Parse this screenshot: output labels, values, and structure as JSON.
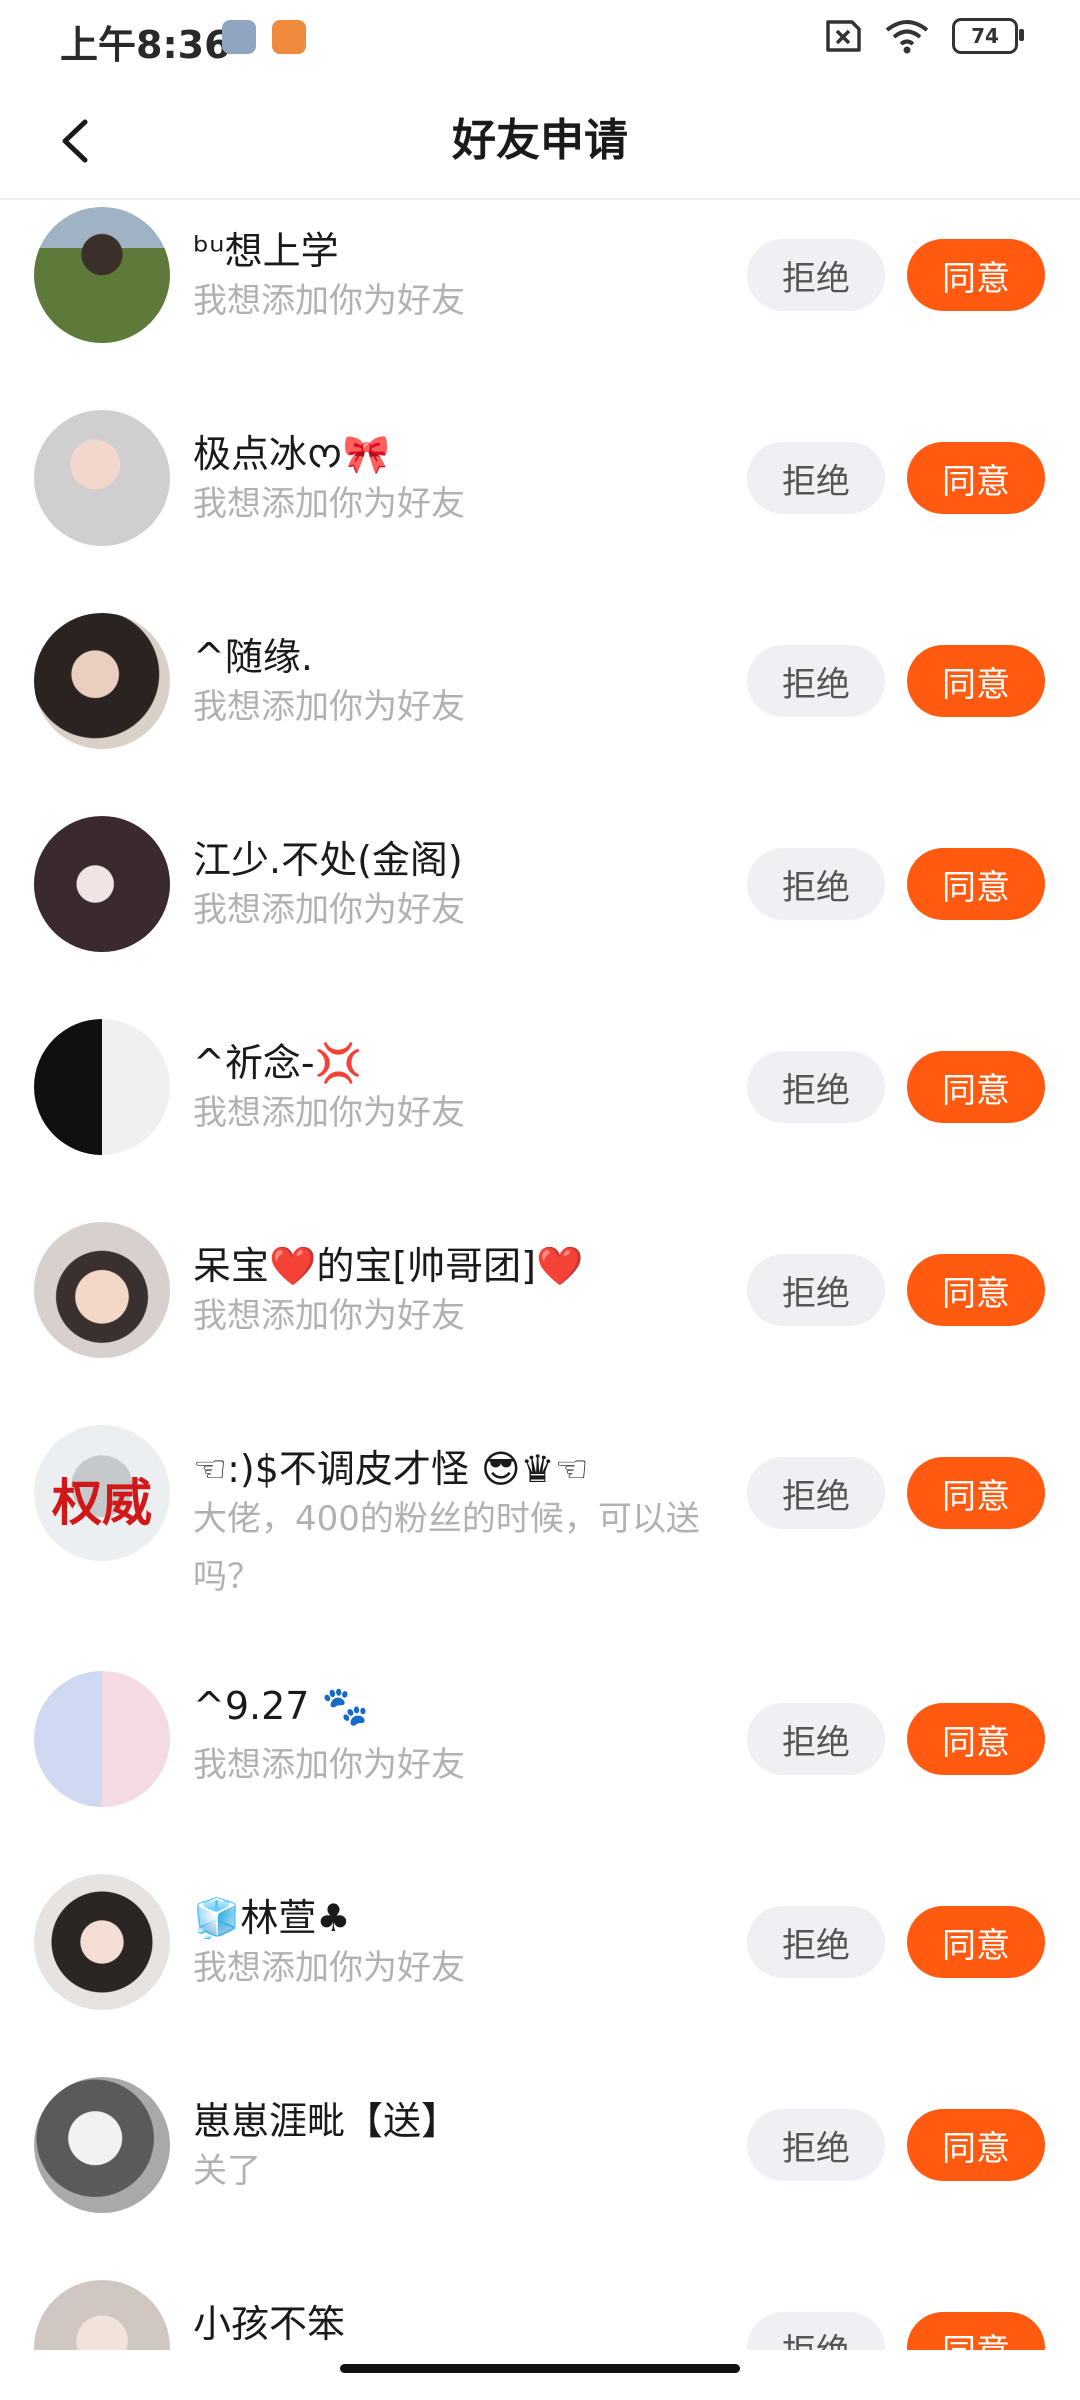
{
  "status_bar": {
    "time": "上午8:36",
    "battery": "74"
  },
  "header": {
    "title": "好友申请"
  },
  "buttons": {
    "reject": "拒绝",
    "accept": "同意"
  },
  "requests": [
    {
      "name": "ᵇᵘ想上学",
      "message": "我想添加你为好友"
    },
    {
      "name": "极点冰ᰔ🎀",
      "message": "我想添加你为好友"
    },
    {
      "name": "^随缘.",
      "message": "我想添加你为好友"
    },
    {
      "name": "江少.不处(金阁)",
      "message": "我想添加你为好友"
    },
    {
      "name": "^祈念-💢",
      "message": "我想添加你为好友"
    },
    {
      "name": "呆宝❤️的宝[帅哥团]❤️",
      "message": "我想添加你为好友"
    },
    {
      "name": "☜:)$不调皮才怪 😎♛☜",
      "message": "大佬，400的粉丝的时候，可以送吗？",
      "avatar_text": "权威"
    },
    {
      "name": "^9.27 🐾",
      "message": "我想添加你为好友"
    },
    {
      "name": "🧊林萱♣",
      "message": "我想添加你为好友"
    },
    {
      "name": "崽崽涯毗【送】",
      "message": "关了"
    },
    {
      "name": "小孩不笨",
      "message": ""
    }
  ]
}
